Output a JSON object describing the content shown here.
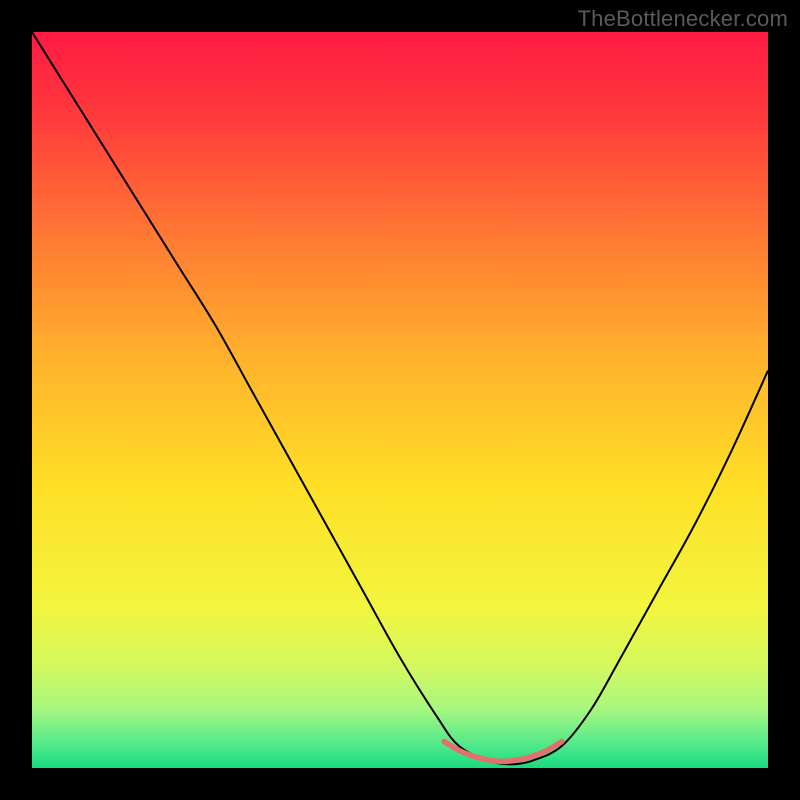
{
  "watermark": "TheBottlenecker.com",
  "chart_data": {
    "type": "line",
    "title": "",
    "xlabel": "",
    "ylabel": "",
    "xlim": [
      0,
      100
    ],
    "ylim": [
      0,
      100
    ],
    "background_gradient": {
      "stops": [
        {
          "offset": 0.0,
          "color": "#ff1a44"
        },
        {
          "offset": 0.12,
          "color": "#ff3c3c"
        },
        {
          "offset": 0.28,
          "color": "#ff7a33"
        },
        {
          "offset": 0.45,
          "color": "#ffb42c"
        },
        {
          "offset": 0.62,
          "color": "#ffe027"
        },
        {
          "offset": 0.78,
          "color": "#f3f53e"
        },
        {
          "offset": 0.86,
          "color": "#d6f85f"
        },
        {
          "offset": 0.92,
          "color": "#a6f780"
        },
        {
          "offset": 0.97,
          "color": "#4fe88b"
        },
        {
          "offset": 1.0,
          "color": "#18db7e"
        }
      ]
    },
    "series": [
      {
        "name": "bottleneck-curve",
        "color": "#000000",
        "width": 2.0,
        "x": [
          0,
          5,
          10,
          15,
          20,
          25,
          30,
          35,
          40,
          45,
          50,
          55,
          58,
          62,
          65,
          68,
          72,
          76,
          80,
          85,
          90,
          95,
          100
        ],
        "y": [
          100,
          92,
          84,
          76,
          68,
          60,
          51,
          42,
          33,
          24,
          15,
          7,
          3,
          1,
          0.5,
          1,
          3,
          8,
          15,
          24,
          33,
          43,
          54
        ]
      },
      {
        "name": "optimal-range",
        "color": "#e2706b",
        "width": 5.5,
        "x": [
          56,
          58,
          60,
          62,
          64,
          66,
          68,
          70,
          72
        ],
        "y": [
          3.6,
          2.4,
          1.6,
          1.1,
          0.9,
          1.1,
          1.6,
          2.4,
          3.6
        ]
      }
    ]
  }
}
